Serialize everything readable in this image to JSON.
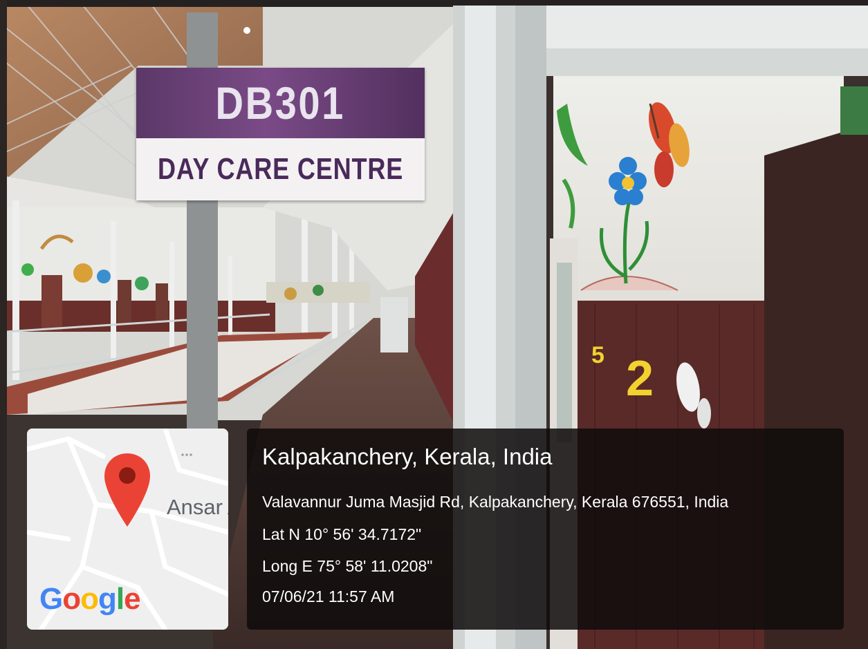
{
  "sign": {
    "code": "DB301",
    "name": "DAY CARE CENTRE"
  },
  "map": {
    "place_label": "Ansar A",
    "brand": {
      "letters": [
        "G",
        "o",
        "o",
        "g",
        "l",
        "e"
      ],
      "colors": [
        "#4285F4",
        "#EA4335",
        "#FBBC05",
        "#4285F4",
        "#34A853",
        "#EA4335"
      ]
    },
    "marker_color": "#EA4335"
  },
  "geotag": {
    "city": "Kalpakanchery, Kerala, India",
    "address": "Valavannur Juma Masjid Rd, Kalpakanchery, Kerala 676551, India",
    "latitude": "Lat N 10° 56' 34.7172\"",
    "longitude": "Long E 75° 58' 11.0208\"",
    "timestamp": "07/06/21 11:57 AM"
  },
  "wall_decor": {
    "number": "2"
  }
}
